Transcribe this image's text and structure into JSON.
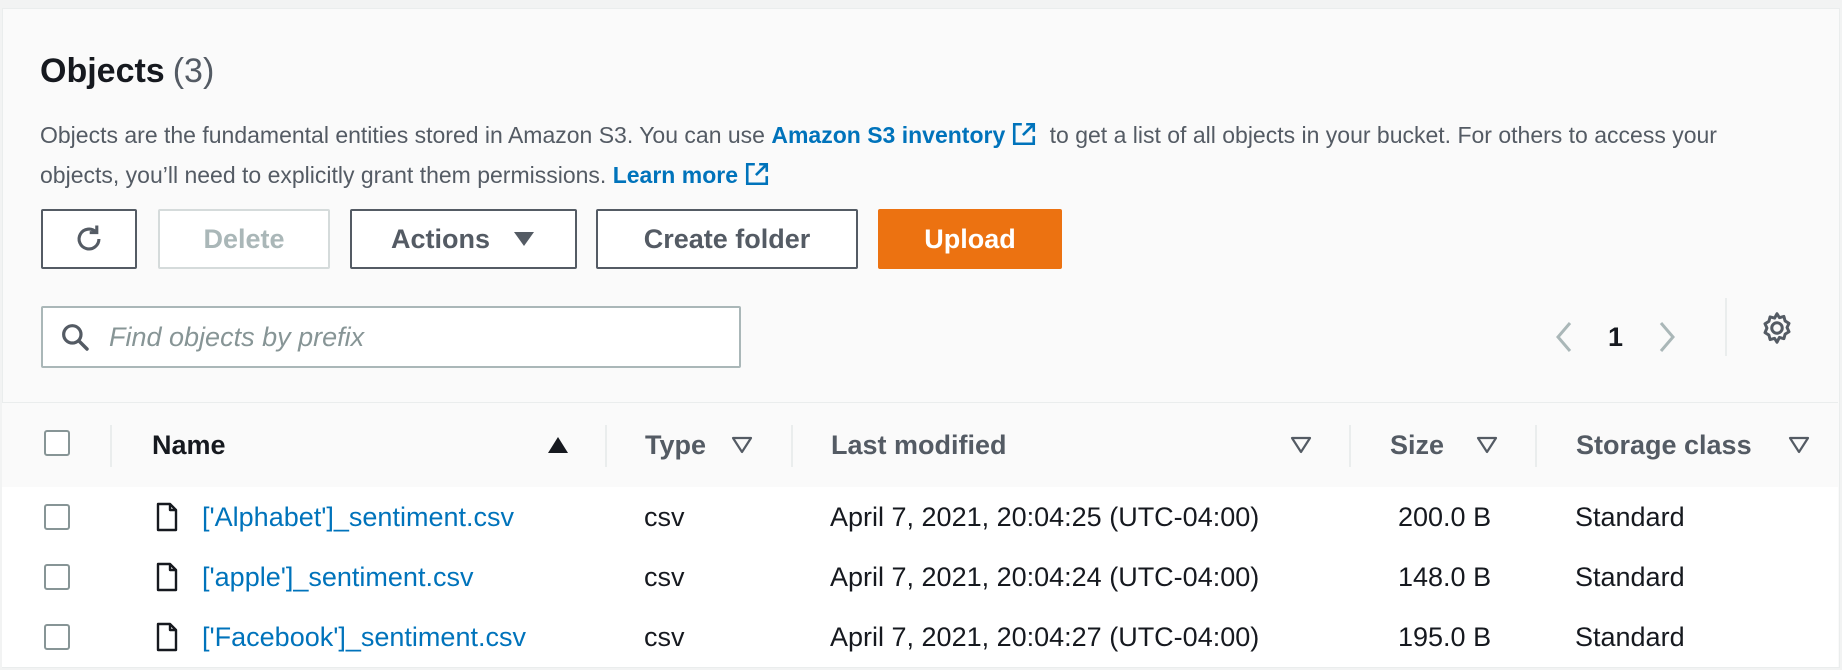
{
  "header": {
    "title": "Objects",
    "count": "(3)"
  },
  "description": {
    "text1": "Objects are the fundamental entities stored in Amazon S3. You can use ",
    "link1": "Amazon S3 inventory",
    "text2": " to get a list of all objects in your bucket. For others to access your objects, you’ll need to explicitly grant them permissions. ",
    "link2": "Learn more"
  },
  "toolbar": {
    "delete_label": "Delete",
    "actions_label": "Actions",
    "create_folder_label": "Create folder",
    "upload_label": "Upload"
  },
  "search": {
    "placeholder": "Find objects by prefix",
    "value": ""
  },
  "pagination": {
    "current_page": "1"
  },
  "table": {
    "columns": {
      "name": "Name",
      "type": "Type",
      "last_modified": "Last modified",
      "size": "Size",
      "storage_class": "Storage class"
    },
    "rows": [
      {
        "name": "['Alphabet']_sentiment.csv",
        "type": "csv",
        "last_modified": "April 7, 2021, 20:04:25 (UTC-04:00)",
        "size": "200.0 B",
        "storage_class": "Standard"
      },
      {
        "name": "['apple']_sentiment.csv",
        "type": "csv",
        "last_modified": "April 7, 2021, 20:04:24 (UTC-04:00)",
        "size": "148.0 B",
        "storage_class": "Standard"
      },
      {
        "name": "['Facebook']_sentiment.csv",
        "type": "csv",
        "last_modified": "April 7, 2021, 20:04:27 (UTC-04:00)",
        "size": "195.0 B",
        "storage_class": "Standard"
      }
    ]
  },
  "colors": {
    "link": "#0073bb",
    "primary": "#ec7211",
    "text": "#16191f",
    "secondary_text": "#545b64"
  }
}
